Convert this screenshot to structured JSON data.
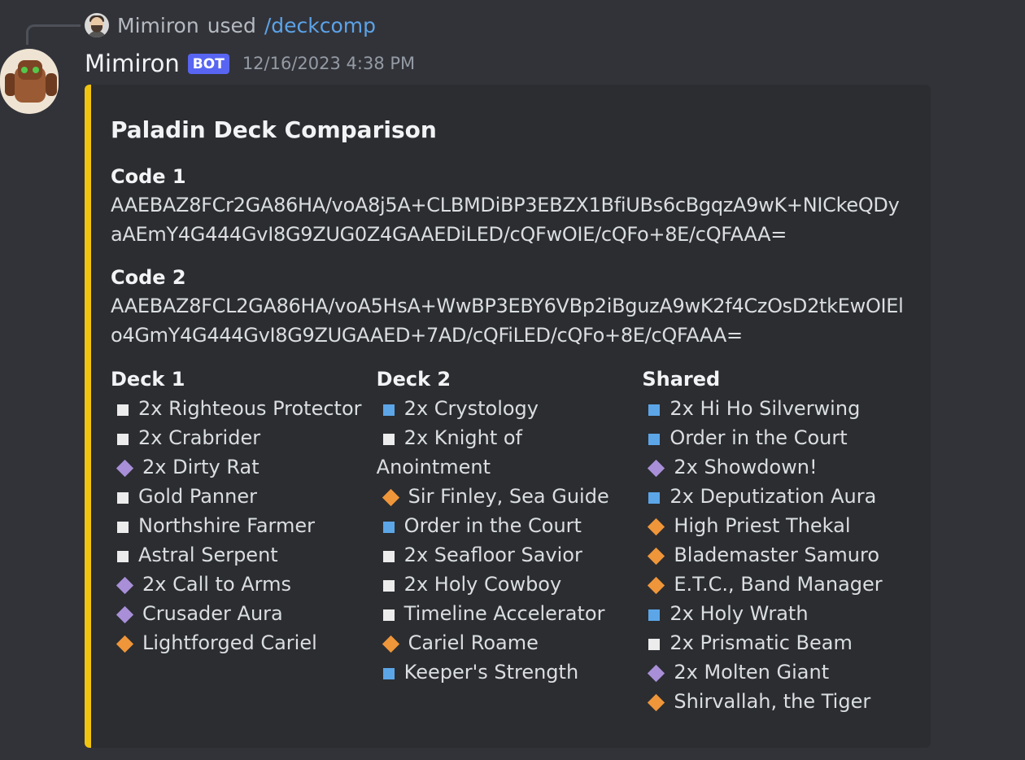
{
  "reply": {
    "user": "Mimiron",
    "used": "used",
    "command": "/deckcomp"
  },
  "message": {
    "author": "Mimiron",
    "bot_tag": "BOT",
    "timestamp": "12/16/2023 4:38 PM"
  },
  "colors": {
    "embed_bar": "#f1c40f",
    "bot_tag": "#5865f2",
    "command_link": "#5ca3e8",
    "rarity_common": "#ececec",
    "rarity_rare": "#5ca6e8",
    "rarity_epic": "#a98fd8",
    "rarity_legendary": "#ef963a"
  },
  "embed": {
    "title": "Paladin Deck Comparison",
    "code1": {
      "name": "Code 1",
      "value": "AAEBAZ8FCr2GA86HA/voA8j5A+CLBMDiBP3EBZX1BfiUBs6cBgqzA9wK+NICkeQDyaAEmY4G444GvI8G9ZUG0Z4GAAEDiLED/cQFwOIE/cQFo+8E/cQFAAA="
    },
    "code2": {
      "name": "Code 2",
      "value": "AAEBAZ8FCL2GA86HA/voA5HsA+WwBP3EBY6VBp2iBguzA9wK2f4CzOsD2tkEwOIElo4GmY4G444GvI8G9ZUGAAED+7AD/cQFiLED/cQFo+8E/cQFAAA="
    },
    "columns": [
      {
        "title": "Deck 1",
        "cards": [
          {
            "name": "2x Righteous Protector",
            "rarity": "common",
            "shape": "square"
          },
          {
            "name": "2x Crabrider",
            "rarity": "common",
            "shape": "square"
          },
          {
            "name": "2x Dirty Rat",
            "rarity": "epic",
            "shape": "diamond"
          },
          {
            "name": "Gold Panner",
            "rarity": "common",
            "shape": "square"
          },
          {
            "name": "Northshire Farmer",
            "rarity": "common",
            "shape": "square"
          },
          {
            "name": "Astral Serpent",
            "rarity": "common",
            "shape": "square"
          },
          {
            "name": "2x Call to Arms",
            "rarity": "epic",
            "shape": "diamond"
          },
          {
            "name": "Crusader Aura",
            "rarity": "epic",
            "shape": "diamond"
          },
          {
            "name": "Lightforged Cariel",
            "rarity": "legendary",
            "shape": "diamond"
          }
        ]
      },
      {
        "title": "Deck 2",
        "cards": [
          {
            "name": "2x Crystology",
            "rarity": "rare",
            "shape": "square"
          },
          {
            "name": "2x Knight of Anointment",
            "rarity": "common",
            "shape": "square"
          },
          {
            "name": "Sir Finley, Sea Guide",
            "rarity": "legendary",
            "shape": "diamond"
          },
          {
            "name": "Order in the Court",
            "rarity": "rare",
            "shape": "square"
          },
          {
            "name": "2x Seafloor Savior",
            "rarity": "common",
            "shape": "square"
          },
          {
            "name": "2x Holy Cowboy",
            "rarity": "common",
            "shape": "square"
          },
          {
            "name": "Timeline Accelerator",
            "rarity": "common",
            "shape": "square"
          },
          {
            "name": "Cariel Roame",
            "rarity": "legendary",
            "shape": "diamond"
          },
          {
            "name": "Keeper's Strength",
            "rarity": "rare",
            "shape": "square"
          }
        ]
      },
      {
        "title": "Shared",
        "cards": [
          {
            "name": "2x Hi Ho Silverwing",
            "rarity": "rare",
            "shape": "square"
          },
          {
            "name": "Order in the Court",
            "rarity": "rare",
            "shape": "square"
          },
          {
            "name": "2x Showdown!",
            "rarity": "epic",
            "shape": "diamond"
          },
          {
            "name": "2x Deputization Aura",
            "rarity": "rare",
            "shape": "square"
          },
          {
            "name": "High Priest Thekal",
            "rarity": "legendary",
            "shape": "diamond"
          },
          {
            "name": "Blademaster Samuro",
            "rarity": "legendary",
            "shape": "diamond"
          },
          {
            "name": "E.T.C., Band Manager",
            "rarity": "legendary",
            "shape": "diamond"
          },
          {
            "name": "2x Holy Wrath",
            "rarity": "rare",
            "shape": "square"
          },
          {
            "name": "2x Prismatic Beam",
            "rarity": "common",
            "shape": "square"
          },
          {
            "name": "2x Molten Giant",
            "rarity": "epic",
            "shape": "diamond"
          },
          {
            "name": "Shirvallah, the Tiger",
            "rarity": "legendary",
            "shape": "diamond"
          }
        ]
      }
    ]
  }
}
